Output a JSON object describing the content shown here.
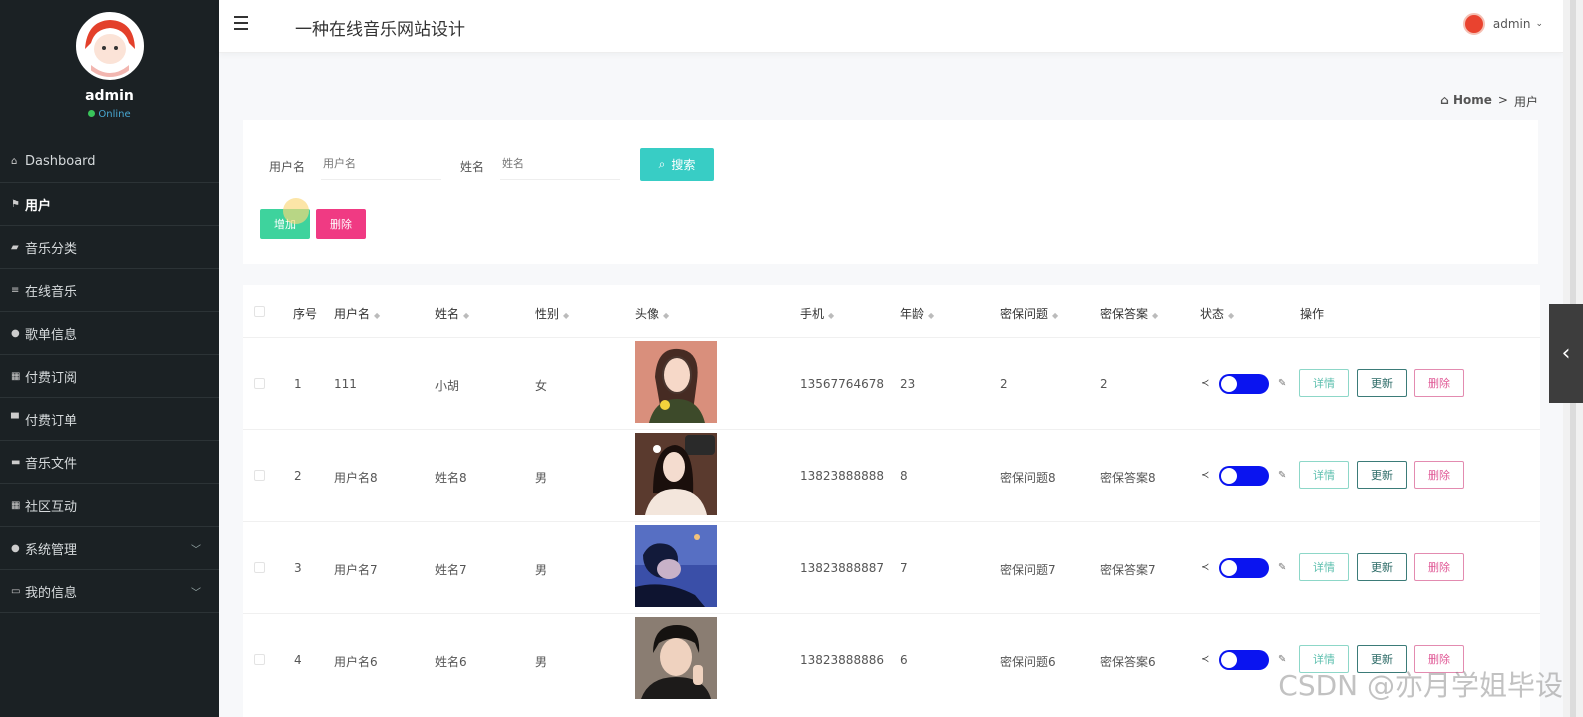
{
  "sidebar": {
    "username": "admin",
    "status": "Online",
    "items": [
      {
        "label": "Dashboard",
        "icon": "home-icon"
      },
      {
        "label": "用户",
        "icon": "flag-icon"
      },
      {
        "label": "音乐分类",
        "icon": "car-icon"
      },
      {
        "label": "在线音乐",
        "icon": "list-icon"
      },
      {
        "label": "歌单信息",
        "icon": "location-icon"
      },
      {
        "label": "付费订阅",
        "icon": "grid-icon"
      },
      {
        "label": "付费订单",
        "icon": "monitor-icon"
      },
      {
        "label": "音乐文件",
        "icon": "id-card-icon"
      },
      {
        "label": "社区互动",
        "icon": "grid-icon"
      },
      {
        "label": "系统管理",
        "icon": "location-icon"
      },
      {
        "label": "我的信息",
        "icon": "card-icon"
      }
    ]
  },
  "header": {
    "title": "一种在线音乐网站设计",
    "user": "admin"
  },
  "breadcrumb": {
    "home": "Home",
    "sep": ">",
    "current": "用户"
  },
  "search": {
    "username_label": "用户名",
    "username_placeholder": "用户名",
    "name_label": "姓名",
    "name_placeholder": "姓名",
    "search_button": "搜索",
    "add_button": "增加",
    "delete_button": "删除"
  },
  "table": {
    "headers": {
      "no": "序号",
      "username": "用户名",
      "name": "姓名",
      "gender": "性别",
      "avatar": "头像",
      "phone": "手机",
      "age": "年龄",
      "question": "密保问题",
      "answer": "密保答案",
      "status": "状态",
      "actions": "操作"
    },
    "actions": {
      "detail": "详情",
      "update": "更新",
      "remove": "删除"
    },
    "rows": [
      {
        "no": "1",
        "username": "111",
        "name": "小胡",
        "gender": "女",
        "phone": "13567764678",
        "age": "23",
        "question": "2",
        "answer": "2",
        "photo_color": "#c97a6a"
      },
      {
        "no": "2",
        "username": "用户名8",
        "name": "姓名8",
        "gender": "男",
        "phone": "13823888888",
        "age": "8",
        "question": "密保问题8",
        "answer": "密保答案8",
        "photo_color": "#5a3a2e"
      },
      {
        "no": "3",
        "username": "用户名7",
        "name": "姓名7",
        "gender": "男",
        "phone": "13823888887",
        "age": "7",
        "question": "密保问题7",
        "answer": "密保答案7",
        "photo_color": "#3a4fa8"
      },
      {
        "no": "4",
        "username": "用户名6",
        "name": "姓名6",
        "gender": "男",
        "phone": "13823888886",
        "age": "6",
        "question": "密保问题6",
        "answer": "密保答案6",
        "photo_color": "#2d2a28"
      }
    ]
  },
  "watermark": "CSDN @亦月学姐毕设"
}
